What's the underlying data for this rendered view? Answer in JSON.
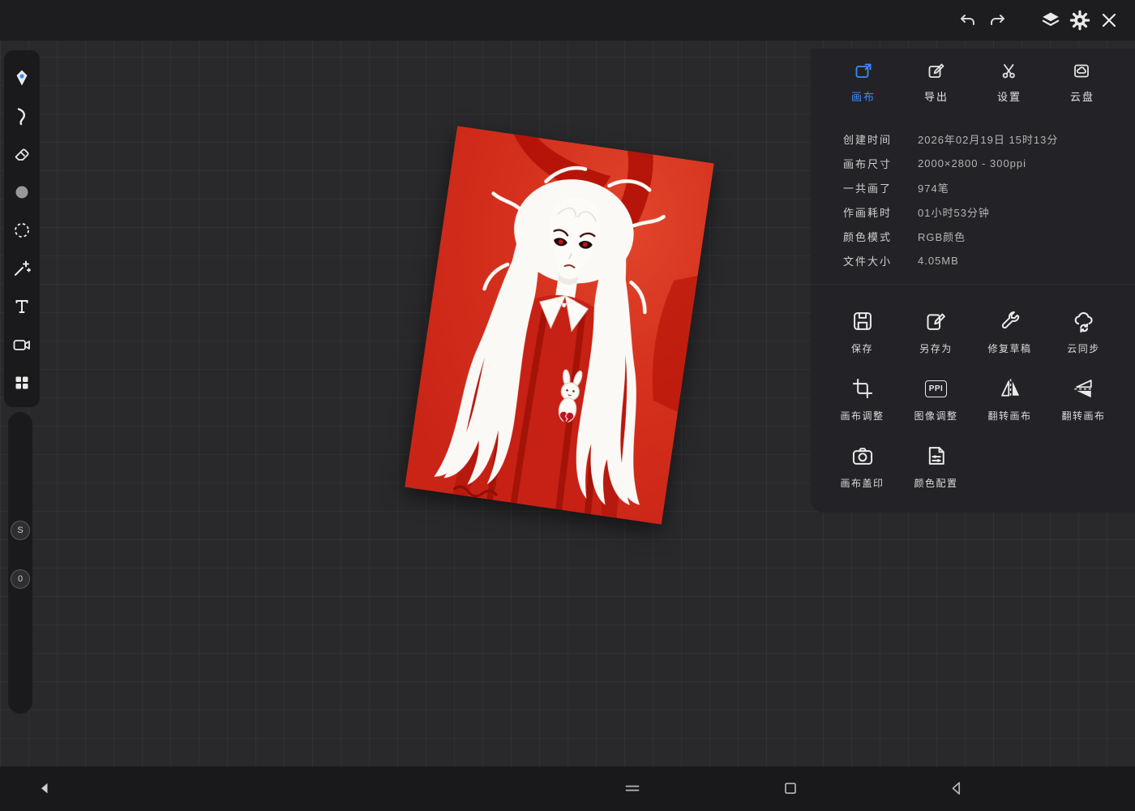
{
  "top_bar": {
    "icons": [
      "undo",
      "redo",
      "layers",
      "settings",
      "close"
    ]
  },
  "toolbar": {
    "tools": [
      "paint-tool",
      "smudge-tool",
      "eraser-tool",
      "color-swatch",
      "selection-tool",
      "magic-wand-tool",
      "text-tool",
      "video-tool",
      "grid-tool"
    ],
    "slider": {
      "top_label": "S",
      "bottom_label": "0"
    }
  },
  "panel": {
    "tabs": [
      {
        "label": "画布",
        "icon": "canvas-tab-icon",
        "active": true
      },
      {
        "label": "导出",
        "icon": "export-tab-icon",
        "active": false
      },
      {
        "label": "设置",
        "icon": "settings-tab-icon",
        "active": false
      },
      {
        "label": "云盘",
        "icon": "cloud-tab-icon",
        "active": false
      }
    ],
    "info": [
      {
        "label": "创建时间",
        "value": "2026年02月19日  15时13分"
      },
      {
        "label": "画布尺寸",
        "value": "2000×2800 - 300ppi"
      },
      {
        "label": "一共画了",
        "value": "974笔"
      },
      {
        "label": "作画耗时",
        "value": "01小时53分钟"
      },
      {
        "label": "颜色模式",
        "value": "RGB颜色"
      },
      {
        "label": "文件大小",
        "value": "4.05MB"
      }
    ],
    "actions": [
      {
        "label": "保存",
        "icon": "save-icon"
      },
      {
        "label": "另存为",
        "icon": "save-as-icon"
      },
      {
        "label": "修复草稿",
        "icon": "repair-draft-icon"
      },
      {
        "label": "云同步",
        "icon": "cloud-sync-icon"
      },
      {
        "label": "画布调整",
        "icon": "crop-icon"
      },
      {
        "label": "图像调整",
        "icon": "ppi-icon",
        "icon_text": "PPI"
      },
      {
        "label": "翻转画布",
        "icon": "flip-horizontal-icon"
      },
      {
        "label": "翻转画布",
        "icon": "flip-vertical-icon"
      },
      {
        "label": "画布盖印",
        "icon": "camera-icon"
      },
      {
        "label": "颜色配置",
        "icon": "color-config-icon"
      }
    ]
  },
  "bottom_bar": {
    "icons": [
      "collapse-sidebar",
      "nav-recents",
      "nav-home",
      "nav-back"
    ]
  },
  "colors": {
    "accent": "#3d8bff",
    "canvas_red": "#d02b1b",
    "panel_bg": "#232327"
  }
}
